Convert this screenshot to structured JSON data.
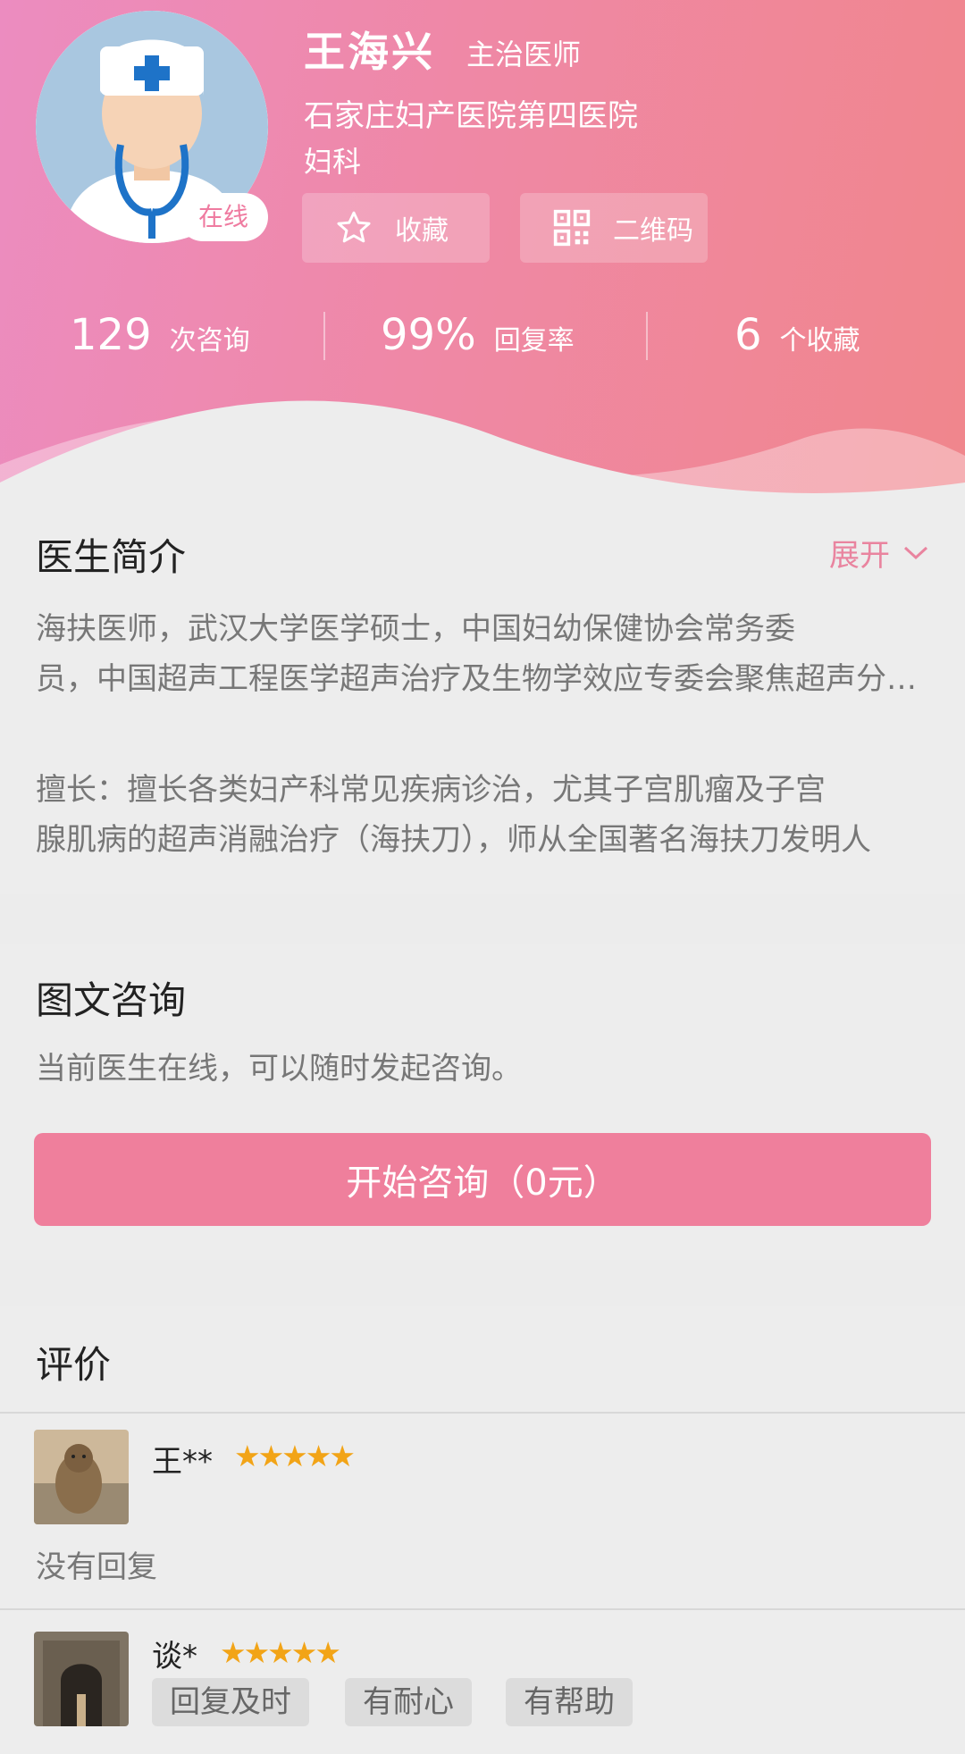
{
  "header": {
    "doctor_name": "王海兴",
    "doctor_title": "主治医师",
    "hospital": "石家庄妇产医院第四医院",
    "department": "妇科",
    "online_badge": "在线",
    "favorite_label": "收藏",
    "qrcode_label": "二维码",
    "stats": [
      {
        "value": "129",
        "label": "次咨询"
      },
      {
        "value": "99%",
        "label": "回复率"
      },
      {
        "value": "6",
        "label": "个收藏"
      }
    ],
    "colors": {
      "gradient_start": "#ec8cc0",
      "gradient_end": "#f0868c"
    }
  },
  "intro": {
    "title": "医生简介",
    "expand_label": "展开",
    "lines": [
      "海扶医师，武汉大学医学硕士，中国妇幼保健协会常务委",
      "员，中国超声工程医学超声治疗及生物学效应专委会聚焦超声分会委员",
      "擅长：擅长各类妇产科常见疾病诊治，尤其子宫肌瘤及子宫",
      "腺肌病的超声消融治疗（海扶刀），师从全国著名海扶刀发明人"
    ]
  },
  "consult": {
    "title": "图文咨询",
    "subtitle": "当前医生在线，可以随时发起咨询。",
    "button_label": "开始咨询（0元）",
    "accent": "#ef7f9c"
  },
  "reviews": {
    "title": "评价",
    "items": [
      {
        "name": "王**",
        "stars": "★★★★★",
        "text": "没有回复",
        "tags": []
      },
      {
        "name": "谈*",
        "stars": "★★★★★",
        "text": "",
        "tags": [
          "回复及时",
          "有耐心",
          "有帮助"
        ]
      }
    ],
    "star_color": "#f2a417"
  }
}
